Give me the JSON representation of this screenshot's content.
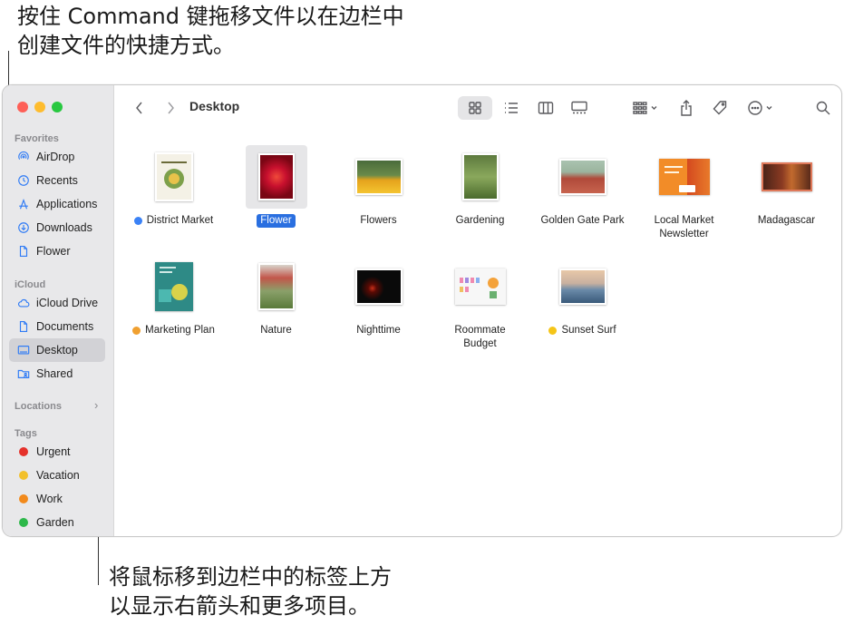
{
  "annotations": {
    "top_line1": "按住 Command 键拖移文件以在边栏中",
    "top_line2": "创建文件的快捷方式。",
    "bottom_line1": "将鼠标移到边栏中的标签上方",
    "bottom_line2": "以显示右箭头和更多项目。"
  },
  "sidebar": {
    "favorites_header": "Favorites",
    "favorites": [
      {
        "label": "AirDrop",
        "icon": "airdrop-icon"
      },
      {
        "label": "Recents",
        "icon": "clock-icon"
      },
      {
        "label": "Applications",
        "icon": "applications-icon"
      },
      {
        "label": "Downloads",
        "icon": "download-icon"
      },
      {
        "label": "Flower",
        "icon": "document-icon"
      }
    ],
    "icloud_header": "iCloud",
    "icloud": [
      {
        "label": "iCloud Drive",
        "icon": "cloud-icon"
      },
      {
        "label": "Documents",
        "icon": "document-icon"
      },
      {
        "label": "Desktop",
        "icon": "desktop-icon",
        "selected": true
      },
      {
        "label": "Shared",
        "icon": "shared-folder-icon"
      }
    ],
    "locations_header": "Locations",
    "tags_header": "Tags",
    "tags": [
      {
        "label": "Urgent",
        "color": "#e5312b"
      },
      {
        "label": "Vacation",
        "color": "#f2c02b"
      },
      {
        "label": "Work",
        "color": "#f28a1c"
      },
      {
        "label": "Garden",
        "color": "#2db84a"
      }
    ]
  },
  "toolbar": {
    "title": "Desktop",
    "icons": [
      "back-icon",
      "forward-icon",
      "icon-view-icon",
      "list-view-icon",
      "column-view-icon",
      "gallery-view-icon",
      "group-icon",
      "share-icon",
      "tag-icon",
      "more-icon",
      "search-icon"
    ]
  },
  "files": [
    {
      "name": "District Market",
      "tag_color": "#3b82f6"
    },
    {
      "name": "Flower",
      "selected": true
    },
    {
      "name": "Flowers"
    },
    {
      "name": "Gardening"
    },
    {
      "name": "Golden Gate Park"
    },
    {
      "name": "Local Market Newsletter"
    },
    {
      "name": "Madagascar"
    },
    {
      "name": "Marketing Plan",
      "tag_color": "#f0a030"
    },
    {
      "name": "Nature"
    },
    {
      "name": "Nighttime"
    },
    {
      "name": "Roommate Budget"
    },
    {
      "name": "Sunset Surf",
      "tag_color": "#f5c518"
    }
  ],
  "colors": {
    "accent": "#2a6fe0",
    "sidebar_bg": "#e8e8ea",
    "selected_sidebar": "#d2d2d6"
  }
}
